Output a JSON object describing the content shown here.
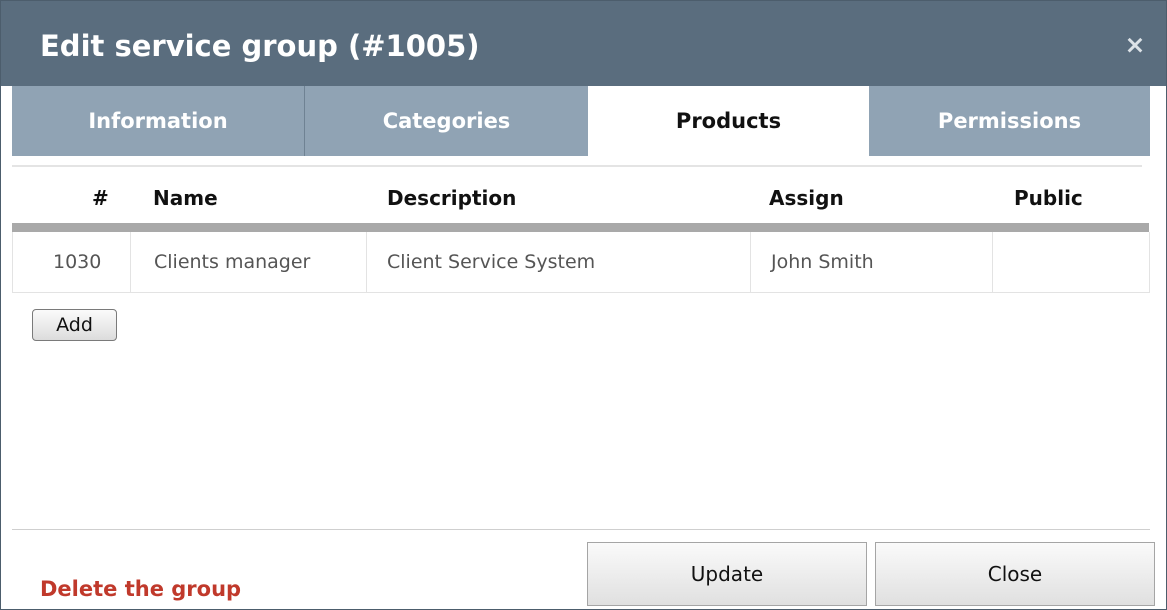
{
  "dialog": {
    "title": "Edit service group (#1005)",
    "close_glyph": "×",
    "close_icon": "close-icon"
  },
  "tabs": [
    {
      "label": "Information",
      "active": false
    },
    {
      "label": "Categories",
      "active": false
    },
    {
      "label": "Products",
      "active": true
    },
    {
      "label": "Permissions",
      "active": false
    }
  ],
  "table": {
    "columns": [
      "#",
      "Name",
      "Description",
      "Assign",
      "Public"
    ],
    "rows": [
      {
        "id": "1030",
        "name": "Clients manager",
        "description": "Client Service System",
        "assign": "John Smith",
        "public": ""
      }
    ]
  },
  "actions": {
    "add_label": "Add",
    "delete_label": "Delete the group",
    "update_label": "Update",
    "close_label": "Close"
  },
  "colors": {
    "titlebar": "#5a6d7e",
    "tab_inactive": "#90a3b4",
    "delete_link": "#c0392b"
  }
}
